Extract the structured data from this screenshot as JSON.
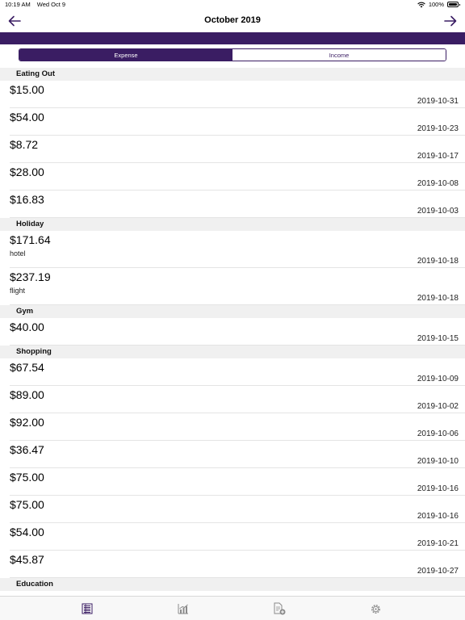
{
  "status_bar": {
    "time": "10:19 AM",
    "date": "Wed Oct 9",
    "battery": "100%"
  },
  "nav": {
    "title": "October 2019"
  },
  "segments": {
    "expense": "Expense",
    "income": "Income"
  },
  "sections": [
    {
      "name": "Eating Out",
      "rows": [
        {
          "amount": "$15.00",
          "date": "2019-10-31"
        },
        {
          "amount": "$54.00",
          "date": "2019-10-23"
        },
        {
          "amount": "$8.72",
          "date": "2019-10-17"
        },
        {
          "amount": "$28.00",
          "date": "2019-10-08"
        },
        {
          "amount": "$16.83",
          "date": "2019-10-03"
        }
      ]
    },
    {
      "name": "Holiday",
      "rows": [
        {
          "amount": "$171.64",
          "note": "hotel",
          "date": "2019-10-18"
        },
        {
          "amount": "$237.19",
          "note": "flight",
          "date": "2019-10-18"
        }
      ]
    },
    {
      "name": "Gym",
      "rows": [
        {
          "amount": "$40.00",
          "date": "2019-10-15"
        }
      ]
    },
    {
      "name": "Shopping",
      "rows": [
        {
          "amount": "$67.54",
          "date": "2019-10-09"
        },
        {
          "amount": "$89.00",
          "date": "2019-10-02"
        },
        {
          "amount": "$92.00",
          "date": "2019-10-06"
        },
        {
          "amount": "$36.47",
          "date": "2019-10-10"
        },
        {
          "amount": "$75.00",
          "date": "2019-10-16"
        },
        {
          "amount": "$75.00",
          "date": "2019-10-16"
        },
        {
          "amount": "$54.00",
          "date": "2019-10-21"
        },
        {
          "amount": "$45.87",
          "date": "2019-10-27"
        }
      ]
    },
    {
      "name": "Education",
      "rows": []
    }
  ],
  "colors": {
    "accent": "#3a1d63",
    "section_bg": "#f0f0f0"
  },
  "tabs": [
    "list-icon",
    "chart-icon",
    "add-document-icon",
    "gear-icon"
  ]
}
